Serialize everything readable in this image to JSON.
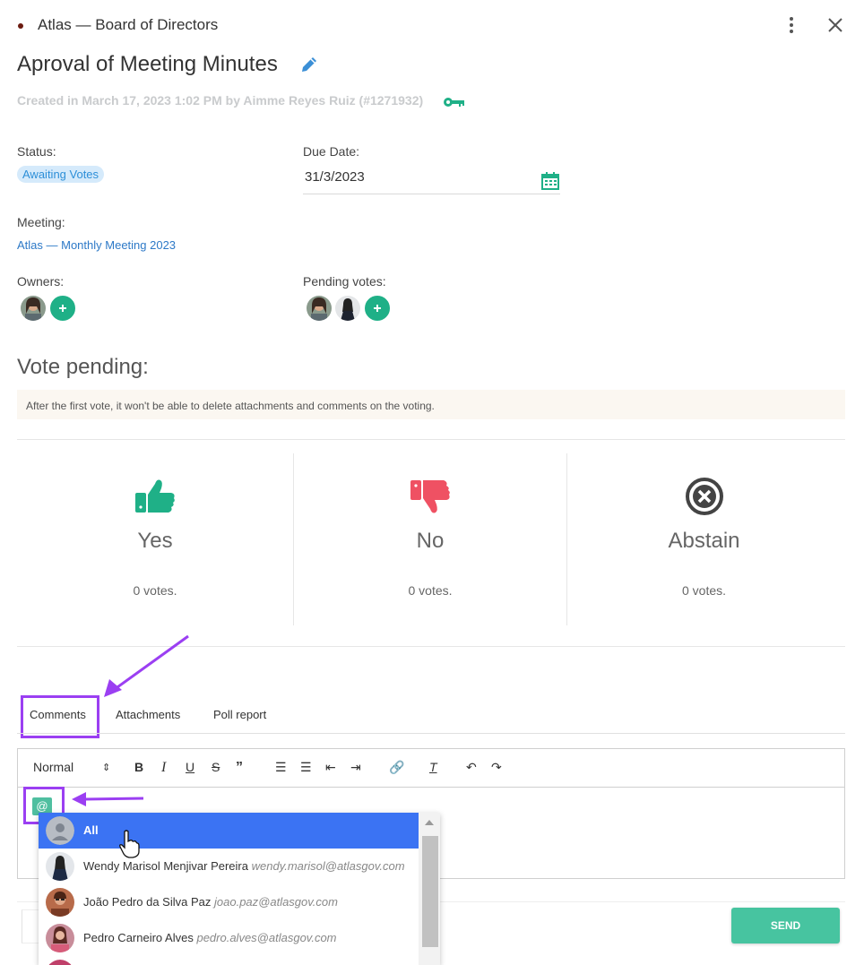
{
  "header": {
    "board": "Atlas — Board of Directors"
  },
  "task": {
    "title": "Aproval of Meeting Minutes",
    "created": "Created in March 17, 2023 1:02 PM by Aimme Reyes Ruiz (#1271932)"
  },
  "fields": {
    "status_label": "Status:",
    "status_value": "Awaiting Votes",
    "due_label": "Due Date:",
    "due_value": "31/3/2023",
    "meeting_label": "Meeting:",
    "meeting_value": "Atlas — Monthly Meeting 2023",
    "owners_label": "Owners:",
    "pending_label": "Pending votes:"
  },
  "vote": {
    "heading": "Vote pending:",
    "notice": "After the first vote, it won't be able to delete attachments and comments on the voting.",
    "options": [
      {
        "name": "Yes",
        "votes": "0 votes.",
        "color": "#1fb087",
        "icon": "thumbs-up-icon"
      },
      {
        "name": "No",
        "votes": "0 votes.",
        "color": "#ef5163",
        "icon": "thumbs-down-icon"
      },
      {
        "name": "Abstain",
        "votes": "0 votes.",
        "color": "#444444",
        "icon": "circle-x-icon"
      }
    ]
  },
  "tabs": [
    {
      "label": "Comments",
      "active": true
    },
    {
      "label": "Attachments",
      "active": false
    },
    {
      "label": "Poll report",
      "active": false
    }
  ],
  "editor": {
    "format": "Normal",
    "mention_chip": "@",
    "send_label": "SEND"
  },
  "mentions": [
    {
      "name": "All",
      "email": "",
      "selected": true
    },
    {
      "name": "Wendy Marisol Menjivar Pereira",
      "email": "wendy.marisol@atlasgov.com",
      "selected": false
    },
    {
      "name": "João Pedro da Silva Paz",
      "email": "joao.paz@atlasgov.com",
      "selected": false
    },
    {
      "name": "Pedro Carneiro Alves",
      "email": "pedro.alves@atlasgov.com",
      "selected": false
    }
  ],
  "colors": {
    "accent": "#1fb087",
    "annotation": "#9b3ff2",
    "link": "#2d79c7",
    "selection": "#3b73f3"
  }
}
